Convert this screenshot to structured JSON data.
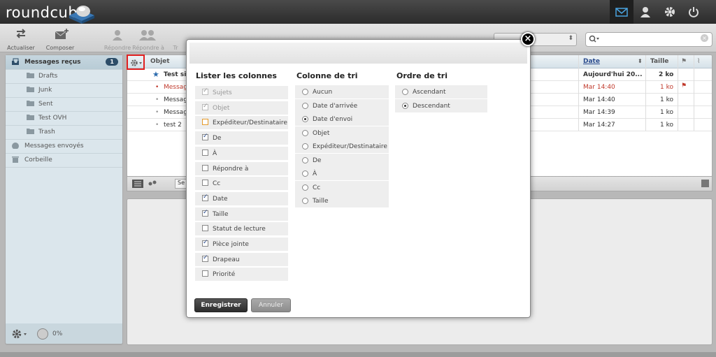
{
  "app": {
    "logo": "roundcube"
  },
  "toolbar": {
    "refresh": "Actualiser",
    "compose": "Composer",
    "reply": "Répondre",
    "reply_all": "Répondre à",
    "forward": "Tr",
    "search_placeholder": ""
  },
  "sidebar": {
    "folders": [
      {
        "label": "Messages reçus",
        "badge": "1"
      },
      {
        "label": "Drafts"
      },
      {
        "label": "Junk"
      },
      {
        "label": "Sent"
      },
      {
        "label": "Test OVH"
      },
      {
        "label": "Trash"
      },
      {
        "label": "Messages envoyés"
      },
      {
        "label": "Corbeille"
      }
    ],
    "quota": "0%"
  },
  "messagelist": {
    "col_subject": "Objet",
    "col_date": "Date",
    "col_size": "Taille",
    "rows": [
      {
        "subject": "Test si",
        "date": "Aujourd'hui 20...",
        "size": "2 ko"
      },
      {
        "subject": "Messag",
        "date": "Mar 14:40",
        "size": "1 ko"
      },
      {
        "subject": "Messag",
        "date": "Mar 14:40",
        "size": "1 ko"
      },
      {
        "subject": "Messag",
        "date": "Mar 14:39",
        "size": "1 ko"
      },
      {
        "subject": "test 2",
        "date": "Mar 14:27",
        "size": "1 ko"
      }
    ],
    "preview_select": "Se"
  },
  "dialog": {
    "col1_title": "Lister les colonnes",
    "col2_title": "Colonne de tri",
    "col3_title": "Ordre de tri",
    "columns": [
      {
        "label": "Sujets",
        "checked": true,
        "disabled": true
      },
      {
        "label": "Objet",
        "checked": true,
        "disabled": true
      },
      {
        "label": "Expéditeur/Destinataire",
        "checked": false,
        "disabled": false
      },
      {
        "label": "De",
        "checked": true,
        "disabled": false
      },
      {
        "label": "À",
        "checked": false,
        "disabled": false
      },
      {
        "label": "Répondre à",
        "checked": false,
        "disabled": false
      },
      {
        "label": "Cc",
        "checked": false,
        "disabled": false
      },
      {
        "label": "Date",
        "checked": true,
        "disabled": false
      },
      {
        "label": "Taille",
        "checked": true,
        "disabled": false
      },
      {
        "label": "Statut de lecture",
        "checked": false,
        "disabled": false
      },
      {
        "label": "Pièce jointe",
        "checked": true,
        "disabled": false
      },
      {
        "label": "Drapeau",
        "checked": true,
        "disabled": false
      },
      {
        "label": "Priorité",
        "checked": false,
        "disabled": false
      }
    ],
    "sort_columns": [
      {
        "label": "Aucun",
        "selected": false
      },
      {
        "label": "Date d'arrivée",
        "selected": false
      },
      {
        "label": "Date d'envoi",
        "selected": true
      },
      {
        "label": "Objet",
        "selected": false
      },
      {
        "label": "Expéditeur/Destinataire",
        "selected": false
      },
      {
        "label": "De",
        "selected": false
      },
      {
        "label": "À",
        "selected": false
      },
      {
        "label": "Cc",
        "selected": false
      },
      {
        "label": "Taille",
        "selected": false
      }
    ],
    "sort_order": [
      {
        "label": "Ascendant",
        "selected": false
      },
      {
        "label": "Descendant",
        "selected": true
      }
    ],
    "save": "Enregistrer",
    "cancel": "Annuler",
    "close": "×"
  },
  "colors": {
    "accent": "#2d4d68",
    "unread_red": "#c0392b",
    "highlight": "#e02020"
  }
}
